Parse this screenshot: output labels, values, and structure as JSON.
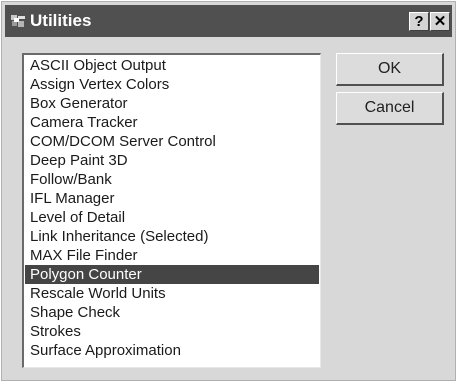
{
  "window": {
    "title": "Utilities",
    "app_icon": "utilities-icon",
    "help_button": "?",
    "close_button": "✕"
  },
  "utilities_list": {
    "items": [
      "ASCII Object Output",
      "Assign Vertex Colors",
      "Box Generator",
      "Camera Tracker",
      "COM/DCOM Server Control",
      "Deep Paint 3D",
      "Follow/Bank",
      "IFL Manager",
      "Level of Detail",
      "Link Inheritance (Selected)",
      "MAX File Finder",
      "Polygon Counter",
      "Rescale World Units",
      "Shape Check",
      "Strokes",
      "Surface Approximation"
    ],
    "selected": "Polygon Counter"
  },
  "buttons": {
    "ok_label": "OK",
    "cancel_label": "Cancel"
  },
  "colors": {
    "title_bar": "#505050",
    "selection": "#454545",
    "dialog_face": "#d8d8d8"
  }
}
